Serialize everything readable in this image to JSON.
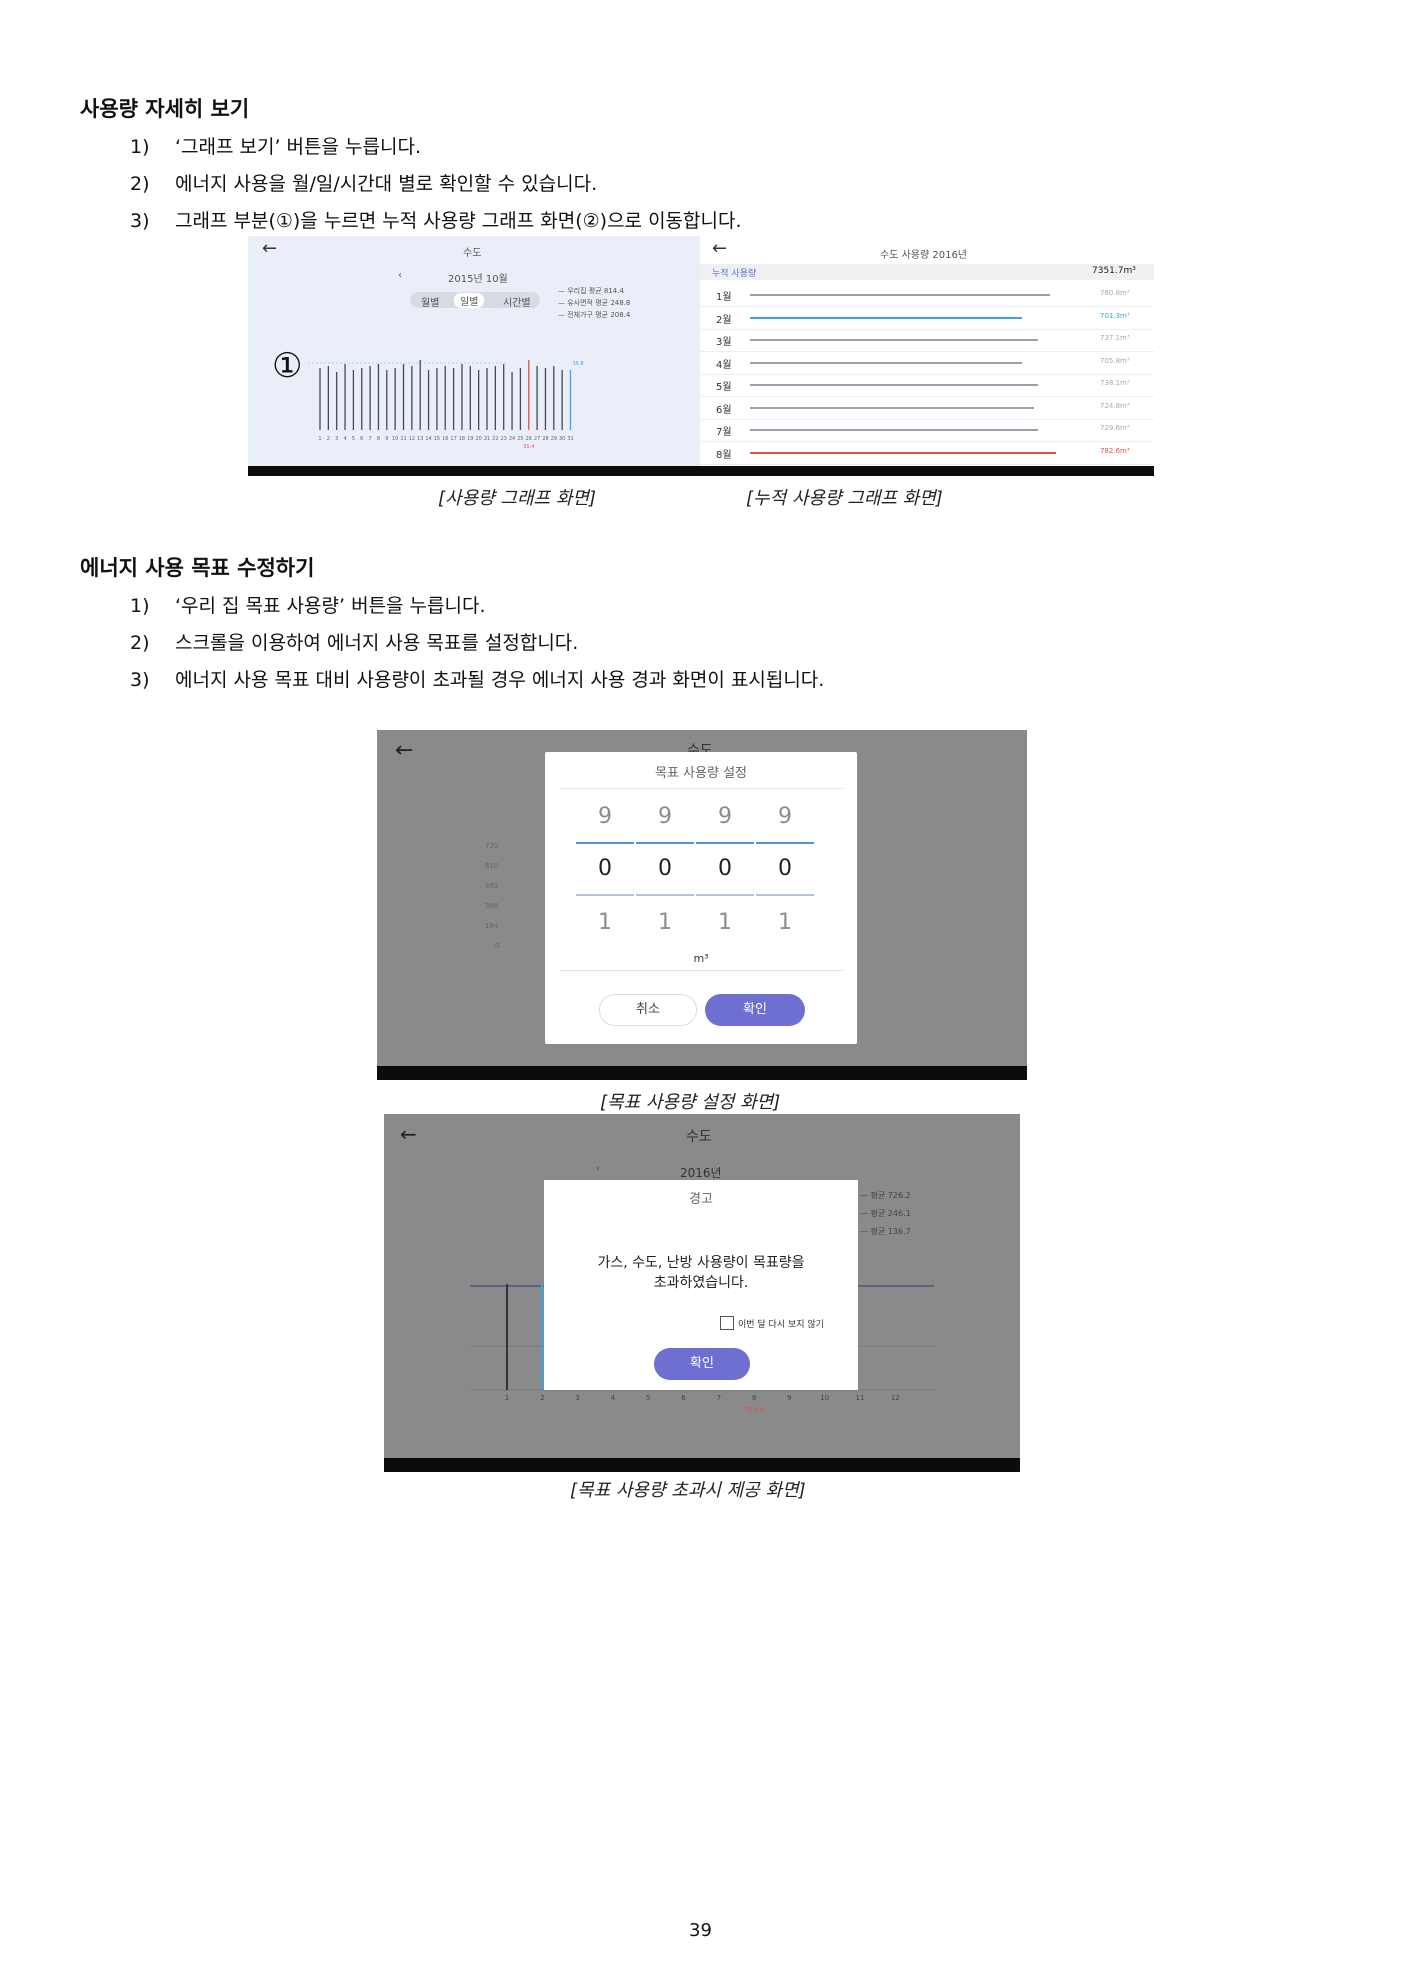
{
  "section1": {
    "title": "사용량 자세히 보기",
    "items": [
      {
        "num": "1)",
        "text": "‘그래프 보기’ 버튼을 누릅니다."
      },
      {
        "num": "2)",
        "text": "에너지 사용을 월/일/시간대 별로 확인할 수 있습니다."
      },
      {
        "num": "3)",
        "text": "그래프 부분(①)을 누르면 누적 사용량 그래프 화면(②)으로 이동합니다."
      }
    ]
  },
  "screen1": {
    "back_icon": "arrow-left-icon",
    "title": "수도",
    "period": "2015년 10월",
    "tabs": [
      "월별",
      "일별",
      "시간별"
    ],
    "legend": [
      "— 우리집 평균 814.4",
      "— 유사면적 평균 248.8",
      "— 전체가구 평균 208.4"
    ],
    "marker": "①",
    "day_labels": [
      "1",
      "2",
      "3",
      "4",
      "5",
      "6",
      "7",
      "8",
      "9",
      "10",
      "11",
      "12",
      "13",
      "14",
      "15",
      "16",
      "17",
      "18",
      "19",
      "20",
      "21",
      "22",
      "23",
      "24",
      "25",
      "26",
      "27",
      "28",
      "29",
      "30",
      "31"
    ],
    "red_label": "31.4",
    "blue_label": "35.8"
  },
  "screen2": {
    "title": "수도 사용량 2016년",
    "total_label": "누적 사용량",
    "total_value": "7351.7m³",
    "months": [
      {
        "label": "1월",
        "value": "760.8m³"
      },
      {
        "label": "2월",
        "value": "701.3m³"
      },
      {
        "label": "3월",
        "value": "737.1m³"
      },
      {
        "label": "4월",
        "value": "705.8m³"
      },
      {
        "label": "5월",
        "value": "738.1m³"
      },
      {
        "label": "6월",
        "value": "724.8m³"
      },
      {
        "label": "7월",
        "value": "729.6m³"
      },
      {
        "label": "8월",
        "value": "782.6m³"
      }
    ]
  },
  "captions": {
    "cap1": "[사용량 그래프 화면]",
    "cap2": "[누적 사용량 그래프 화면]",
    "cap3": "[목표 사용량 설정 화면]",
    "cap4": "[목표 사용량 초과시 제공 화면]"
  },
  "section2": {
    "title": "에너지 사용 목표 수정하기",
    "items": [
      {
        "num": "1)",
        "text": "‘우리 집 목표 사용량’ 버튼을 누릅니다."
      },
      {
        "num": "2)",
        "text": "스크롤을 이용하여 에너지 사용 목표를 설정합니다."
      },
      {
        "num": "3)",
        "text": "에너지 사용 목표 대비 사용량이 초과될 경우 에너지 사용 경과 화면이 표시됩니다."
      }
    ]
  },
  "screen3": {
    "bg_title": "수도",
    "dialog_title": "목표 사용량 설정",
    "row_top": [
      "9",
      "9",
      "9",
      "9"
    ],
    "row_mid": [
      "0",
      "0",
      "0",
      "0"
    ],
    "row_bot": [
      "1",
      "1",
      "1",
      "1"
    ],
    "unit": "m³",
    "cancel": "취소",
    "confirm": "확인",
    "bg_axis": [
      "720",
      "610",
      "483",
      "366",
      "184",
      "0"
    ]
  },
  "screen4": {
    "bg_title": "수도",
    "bg_year": "2016년",
    "bg_legend": [
      "— 평균 726.2",
      "— 평균 246.1",
      "— 평균 136.7"
    ],
    "dialog_title": "경고",
    "message_line1": "가스, 수도, 난방 사용량이 목표량을",
    "message_line2": "초과하였습니다.",
    "checkbox_label": "이번 달 다시 보지 않기",
    "confirm": "확인",
    "x_labels": [
      "1",
      "2",
      "3",
      "4",
      "5",
      "6",
      "7",
      "8",
      "9",
      "10",
      "11",
      "12"
    ],
    "red_value": "753.0"
  },
  "page_number": "39",
  "colors": {
    "accent": "#6f6fd1",
    "blue": "#3aa3e0",
    "red": "#e0504a"
  }
}
